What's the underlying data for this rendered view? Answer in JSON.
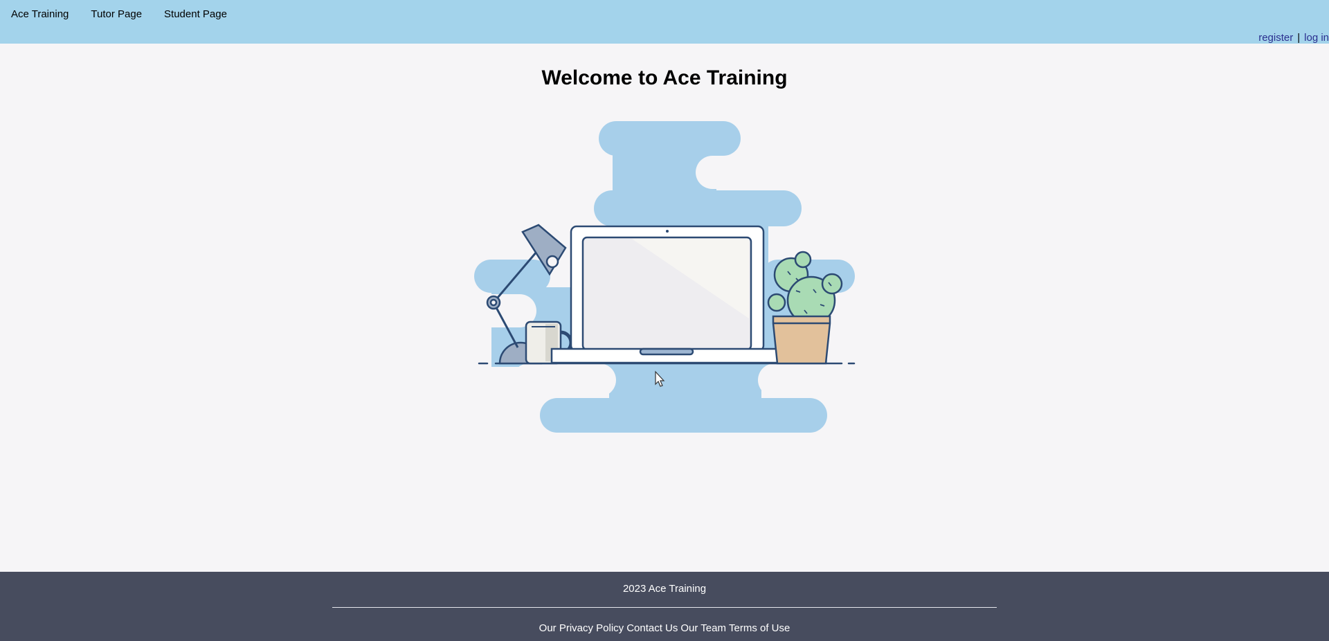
{
  "nav": {
    "items": [
      {
        "label": "Ace Training"
      },
      {
        "label": "Tutor Page"
      },
      {
        "label": "Student Page"
      }
    ],
    "register": "register",
    "separator": "|",
    "login": "log in"
  },
  "main": {
    "title": "Welcome to Ace Training",
    "illustration_icon": "desk-laptop-illustration"
  },
  "footer": {
    "copyright": "2023 Ace Training",
    "links": {
      "privacy": "Our Privacy Policy",
      "contact": "Contact Us",
      "team": "Our Team",
      "terms": "Terms of Use"
    }
  },
  "colors": {
    "navbar": "#a3d3eb",
    "background": "#f6f5f7",
    "footer": "#474c5e",
    "accent_blob": "#a7cfea",
    "outline": "#2c4a73"
  }
}
